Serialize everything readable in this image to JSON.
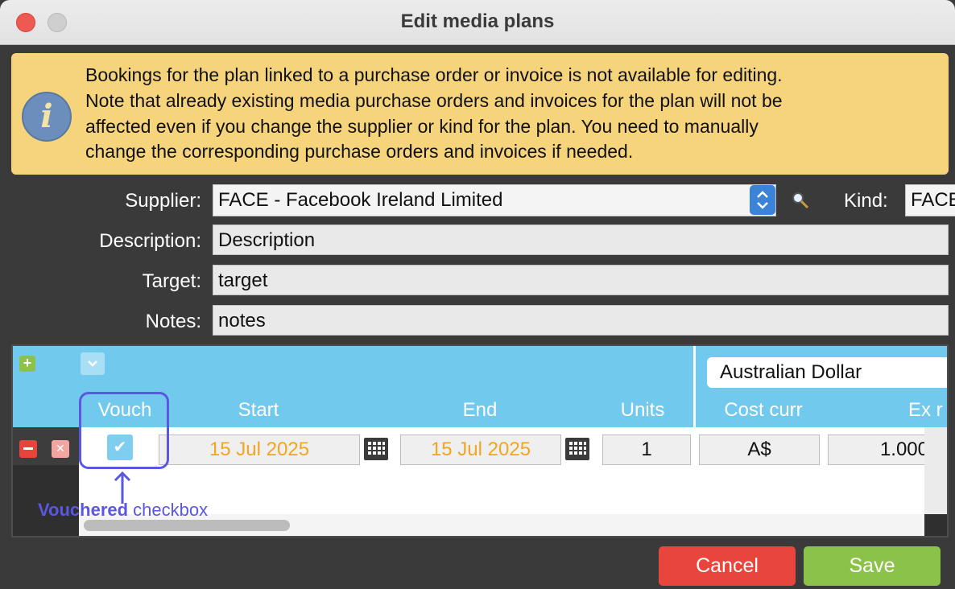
{
  "window": {
    "title": "Edit media plans"
  },
  "info": {
    "icon": "info-icon",
    "lines": [
      "Bookings for the plan linked to a purchase order or invoice is not available for editing.",
      "Note that already existing media purchase orders and invoices for the plan will not be",
      "affected even if you change the supplier or kind for the plan.  You need to manually",
      "change the corresponding purchase orders and invoices if needed."
    ]
  },
  "form": {
    "supplier_label": "Supplier:",
    "supplier_value": "FACE - Facebook Ireland Limited",
    "kind_label": "Kind:",
    "kind_value": "FACE",
    "description_label": "Description:",
    "description_value": "Description",
    "target_label": "Target:",
    "target_value": "target",
    "notes_label": "Notes:",
    "notes_value": "notes"
  },
  "grid": {
    "currency": "Australian Dollar",
    "columns": {
      "vouch": "Vouch",
      "start": "Start",
      "end": "End",
      "units": "Units",
      "cost_curr": "Cost curr",
      "ex_rate": "Ex r"
    },
    "row": {
      "vouched": true,
      "start": "15 Jul 2025",
      "end": "15 Jul 2025",
      "units": "1",
      "cost_curr": "A$",
      "ex_rate": "1.000"
    }
  },
  "annotation": {
    "bold": "Vouchered",
    "rest": " checkbox",
    "color": "#5b57e0"
  },
  "buttons": {
    "cancel": "Cancel",
    "save": "Save"
  },
  "colors": {
    "header": "#71c9ee",
    "banner": "#f6d47c",
    "cancel": "#e8453c",
    "save": "#8bc34a",
    "date_text": "#f2a51f"
  }
}
